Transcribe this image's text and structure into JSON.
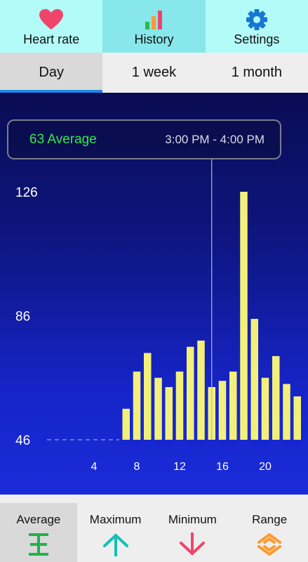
{
  "nav": {
    "items": [
      {
        "label": "Heart rate",
        "icon": "heart-icon",
        "color": "#f0456b"
      },
      {
        "label": "History",
        "icon": "bar-chart-icon",
        "active": true
      },
      {
        "label": "Settings",
        "icon": "gear-icon",
        "color": "#1676d2"
      }
    ]
  },
  "tabs": [
    {
      "label": "Day",
      "active": true
    },
    {
      "label": "1 week"
    },
    {
      "label": "1 month"
    }
  ],
  "tooltip": {
    "average": "63 Average",
    "time_range": "3:00 PM - 4:00 PM"
  },
  "chart_data": {
    "type": "bar",
    "y_ticks": [
      "126",
      "86",
      "46"
    ],
    "x_ticks": [
      "4",
      "8",
      "12",
      "16",
      "20"
    ],
    "ylim": [
      46,
      126
    ],
    "xlim": [
      0,
      23
    ],
    "bar_color": "#f3f07a",
    "selected_hour": 15,
    "series": [
      {
        "x": [
          7,
          8,
          9,
          10,
          11,
          12,
          13,
          14,
          15,
          16,
          17,
          18,
          19,
          20,
          21,
          22,
          23
        ],
        "values": [
          56,
          68,
          74,
          66,
          63,
          68,
          76,
          78,
          63,
          65,
          68,
          126,
          85,
          66,
          73,
          64,
          60
        ]
      }
    ]
  },
  "metrics": [
    {
      "label": "Average",
      "icon": "average-icon",
      "color": "#21b24a",
      "active": true
    },
    {
      "label": "Maximum",
      "icon": "arrow-up-icon",
      "color": "#15c0b5"
    },
    {
      "label": "Minimum",
      "icon": "arrow-down-icon",
      "color": "#f0456b"
    },
    {
      "label": "Range",
      "icon": "range-icon",
      "color": "#ff9a2e"
    }
  ]
}
